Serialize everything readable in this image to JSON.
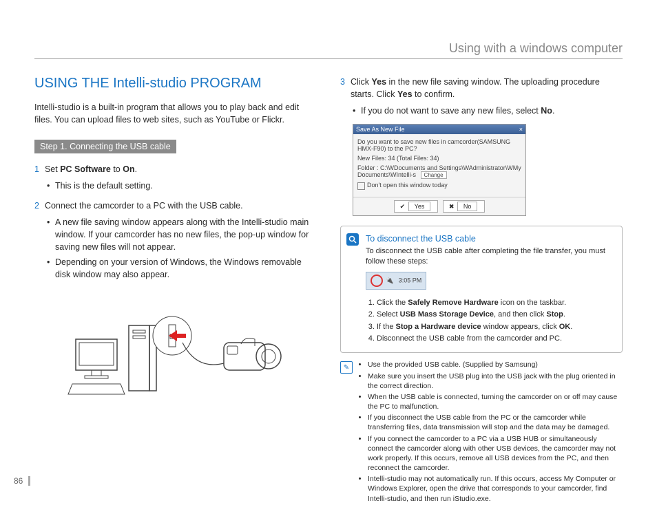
{
  "header": {
    "title": "Using with a windows computer"
  },
  "section_title": "USING THE Intelli-studio PROGRAM",
  "intro": "Intelli-studio is a built-in program that allows you to play back and edit files. You can upload files to web sites, such as YouTube or Flickr.",
  "step_label": "Step 1. Connecting the USB cable",
  "left": {
    "item1_pre": "Set ",
    "item1_b1": "PC Software",
    "item1_mid": " to ",
    "item1_b2": "On",
    "item1_post": ".",
    "item1_sub1": "This is the default setting.",
    "item2": "Connect the camcorder to a PC with the USB cable.",
    "item2_sub1": "A new file saving window appears along with the Intelli-studio main window. If your camcorder has no new files, the pop-up window for saving new files will not appear.",
    "item2_sub2": "Depending on your version of Windows, the Windows removable disk window may also appear."
  },
  "right": {
    "item3_a": "Click ",
    "item3_b1": "Yes",
    "item3_b": " in the new file saving window. The uploading procedure starts. Click ",
    "item3_b2": "Yes",
    "item3_c": " to confirm.",
    "item3_sub_a": "If you do not want to save any new files, select ",
    "item3_sub_b": "No",
    "item3_sub_c": "."
  },
  "dialog": {
    "title": "Save As New File",
    "q": "Do you want to save new files in camcorder(SAMSUNG HMX-F90) to the PC?",
    "files": "New Files: 34 (Total Files: 34)",
    "folder_label": "Folder :",
    "folder_path": "C:\\WDocuments and Settings\\WAdministrator\\WMy Documents\\WIntelli-s",
    "change": "Change",
    "dont": "Don't open this window today",
    "yes": "Yes",
    "no": "No"
  },
  "disconnect": {
    "title": "To disconnect the USB cable",
    "intro": "To disconnect the USB cable after completing the file transfer, you must follow these steps:",
    "time": "3:05 PM",
    "s1_a": "Click the ",
    "s1_b": "Safely Remove Hardware",
    "s1_c": " icon on the taskbar.",
    "s2_a": "Select ",
    "s2_b": "USB Mass Storage Device",
    "s2_c": ", and then click ",
    "s2_d": "Stop",
    "s2_e": ".",
    "s3_a": "If the ",
    "s3_b": "Stop a Hardware device",
    "s3_c": " window appears, click ",
    "s3_d": "OK",
    "s3_e": ".",
    "s4": "Disconnect the USB cable from the camcorder and PC."
  },
  "notes": {
    "n1": "Use the provided USB cable. (Supplied by Samsung)",
    "n2": "Make sure you insert the USB plug into the USB jack with the plug oriented in the correct direction.",
    "n3": "When the USB cable is connected, turning the camcorder on or off may cause the PC to malfunction.",
    "n4": "If you disconnect the USB cable from the PC or the camcorder while transferring files, data transmission will stop and the data may be damaged.",
    "n5": "If you connect the camcorder to a PC via a USB HUB or simultaneously connect the camcorder along with other USB devices, the camcorder may not work properly. If this occurs, remove all USB devices from the PC, and then reconnect the camcorder.",
    "n6": "Intelli-studio may not automatically run. If this occurs, access My Computer or Windows Explorer, open the drive that corresponds to your camcorder, find Intelli-studio, and then run iStudio.exe."
  },
  "page_number": "86"
}
